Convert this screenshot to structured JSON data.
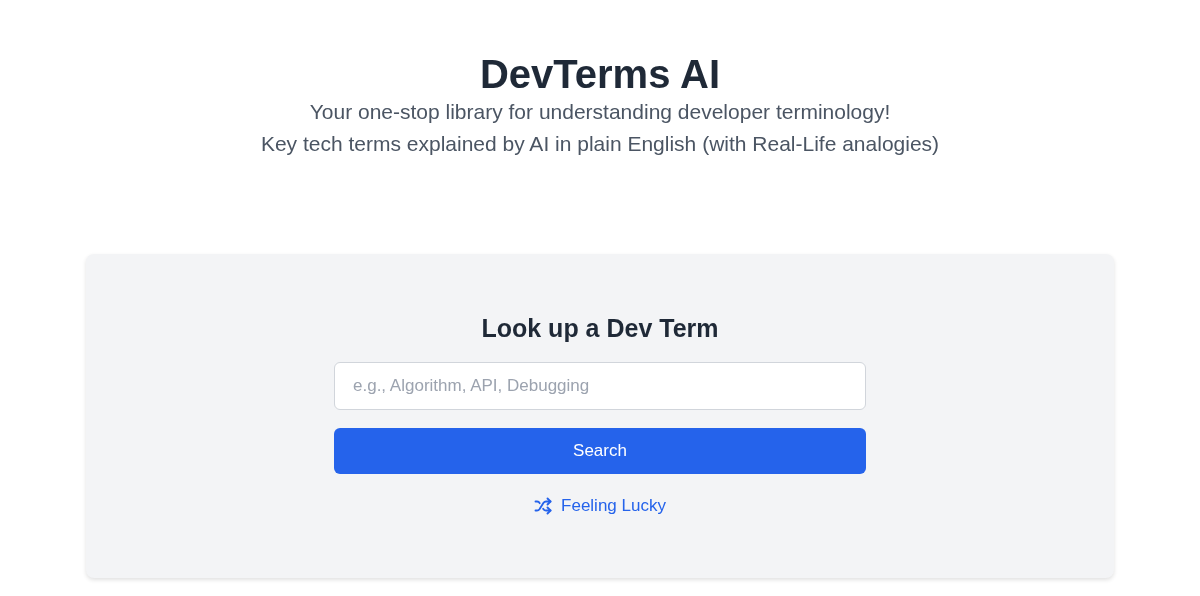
{
  "header": {
    "title": "DevTerms AI",
    "subtitle_lines": [
      "Your one-stop library for understanding developer terminology!",
      "Key tech terms explained by AI in plain English (with Real-Life analogies)"
    ]
  },
  "search_card": {
    "heading": "Look up a Dev Term",
    "search": {
      "placeholder": "e.g., Algorithm, API, Debugging"
    },
    "button": "Search",
    "link": "Feeling Lucky"
  }
}
